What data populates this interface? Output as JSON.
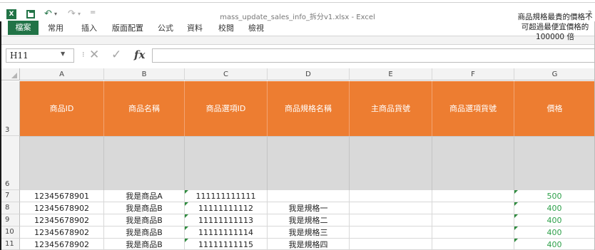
{
  "window": {
    "title": "mass_update_sales_info_拆分v1.xlsx - Excel",
    "help": "?"
  },
  "quick_access": {
    "logo": "X",
    "undo": "↶",
    "undo_dd": "▾",
    "redo": "↷",
    "redo_dd": "▾",
    "sep": "="
  },
  "ribbon": {
    "tabs": [
      "檔案",
      "常用",
      "插入",
      "版面配置",
      "公式",
      "資料",
      "校閱",
      "檢視"
    ]
  },
  "formula_bar": {
    "name_box": "H11",
    "cancel": "✕",
    "enter": "✓",
    "fx": "fx",
    "dots": "⁝",
    "dd": "▼",
    "value": ""
  },
  "columns": [
    "A",
    "B",
    "C",
    "D",
    "E",
    "F",
    "G"
  ],
  "row_numbers": {
    "header": "3",
    "note": "6",
    "data": [
      "7",
      "8",
      "9",
      "10",
      "11"
    ]
  },
  "header_row": [
    "商品ID",
    "商品名稱",
    "商品選項ID",
    "商品規格名稱",
    "主商品貨號",
    "商品選項貨號",
    "價格"
  ],
  "note_row": {
    "G": [
      "商品規格最貴的價格不",
      "可超過最便宜價格的",
      "100000 倍"
    ]
  },
  "data_rows": [
    {
      "A": "12345678901",
      "B": "我是商品A",
      "C": "111111111111",
      "D": "",
      "E": "",
      "F": "",
      "G": "500"
    },
    {
      "A": "12345678902",
      "B": "我是商品B",
      "C": "11111111112",
      "D": "我是規格一",
      "E": "",
      "F": "",
      "G": "400"
    },
    {
      "A": "12345678902",
      "B": "我是商品B",
      "C": "11111111113",
      "D": "我是規格二",
      "E": "",
      "F": "",
      "G": "400"
    },
    {
      "A": "12345678902",
      "B": "我是商品B",
      "C": "11111111114",
      "D": "我是規格三",
      "E": "",
      "F": "",
      "G": "400"
    },
    {
      "A": "12345678902",
      "B": "我是商品B",
      "C": "11111111115",
      "D": "我是規格四",
      "E": "",
      "F": "",
      "G": "400"
    }
  ],
  "colors": {
    "excel_green": "#217346",
    "header_orange": "#ed7d31",
    "note_gray": "#d9d9d9",
    "price_green": "#2ea04a"
  }
}
